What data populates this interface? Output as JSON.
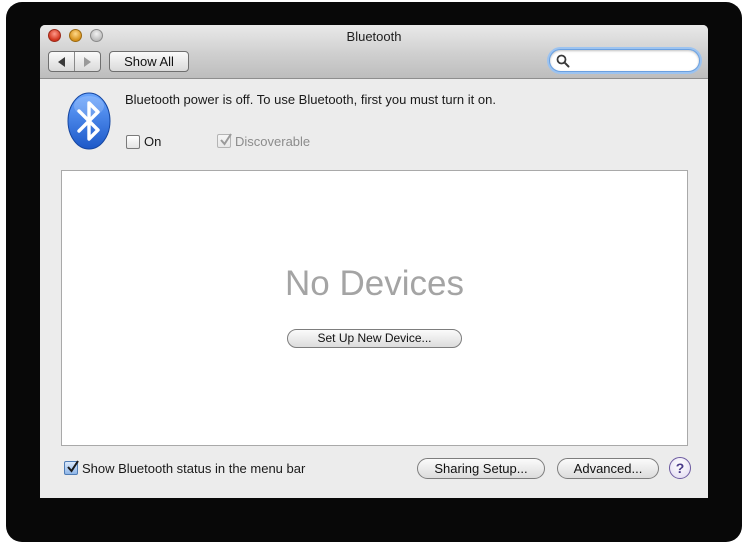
{
  "window": {
    "title": "Bluetooth"
  },
  "toolbar": {
    "back_icon": "chevron-left-icon",
    "forward_icon": "chevron-right-icon",
    "show_all_label": "Show All",
    "search_value": "",
    "search_placeholder": ""
  },
  "bluetooth": {
    "logo_icon": "bluetooth-icon",
    "status_message": "Bluetooth power is off. To use Bluetooth, first you must turn it on.",
    "on_label": "On",
    "on_checked": false,
    "discoverable_label": "Discoverable",
    "discoverable_checked": true,
    "discoverable_enabled": false
  },
  "devices": {
    "empty_message": "No Devices",
    "setup_button_label": "Set Up New Device..."
  },
  "footer": {
    "show_status_label": "Show Bluetooth status in the menu bar",
    "show_status_checked": true,
    "sharing_setup_label": "Sharing Setup...",
    "advanced_label": "Advanced...",
    "help_label": "?"
  },
  "colors": {
    "accent_blue": "#2f6fd8",
    "focus_ring": "#9cc3f0",
    "empty_text_gray": "#a4a4a4"
  }
}
